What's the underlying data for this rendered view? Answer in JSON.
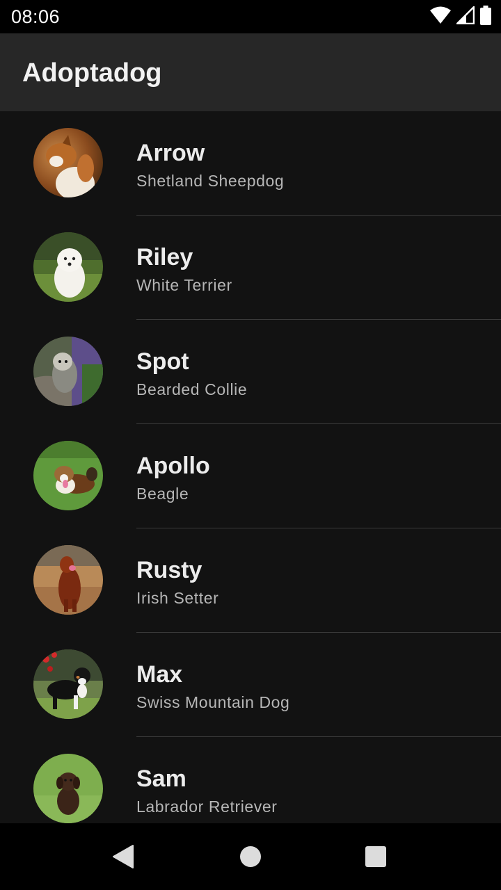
{
  "status_bar": {
    "time": "08:06",
    "icons": [
      "wifi-icon",
      "cell-signal-icon",
      "battery-icon"
    ]
  },
  "app_bar": {
    "title": "Adoptadog"
  },
  "dogs": [
    {
      "name": "Arrow",
      "breed": "Shetland Sheepdog",
      "photo": "sheltie-photo"
    },
    {
      "name": "Riley",
      "breed": "White Terrier",
      "photo": "white-terrier-photo"
    },
    {
      "name": "Spot",
      "breed": "Bearded Collie",
      "photo": "bearded-collie-photo"
    },
    {
      "name": "Apollo",
      "breed": "Beagle",
      "photo": "beagle-photo"
    },
    {
      "name": "Rusty",
      "breed": "Irish Setter",
      "photo": "irish-setter-photo"
    },
    {
      "name": "Max",
      "breed": "Swiss Mountain Dog",
      "photo": "swiss-mountain-dog-photo"
    },
    {
      "name": "Sam",
      "breed": "Labrador Retriever",
      "photo": "labrador-photo"
    }
  ],
  "nav_bar": {
    "icons": [
      "back-icon",
      "home-icon",
      "recents-icon"
    ]
  },
  "colors": {
    "background": "#121212",
    "app_bar": "#272727",
    "status_bar": "#000000",
    "primary_text": "#ececec",
    "secondary_text": "#b6b6b6",
    "divider": "#3a3a3a"
  }
}
